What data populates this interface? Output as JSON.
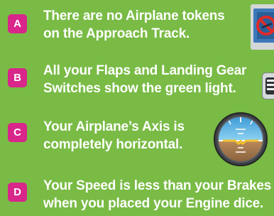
{
  "conditions": [
    {
      "letter": "A",
      "line1": "There are no Airplane tokens",
      "line2": "on the Approach Track."
    },
    {
      "letter": "B",
      "line1": "All your Flaps and Landing Gear",
      "line2": "Switches show the green light."
    },
    {
      "letter": "C",
      "line1": "Your Airplane’s Axis is",
      "line2": "completely horizontal."
    },
    {
      "letter": "D",
      "line1": "Your Speed is less than your Brakes",
      "line2": "when you placed your Engine dice."
    }
  ],
  "colors": {
    "background": "#79bb45",
    "badge": "#d8268a",
    "text": "#ffffff",
    "switch_light": "#6ccb3c",
    "no_symbol": "#e02a2a"
  },
  "icons": {
    "a": "no-airplane-token-icon",
    "b": "switch-icon",
    "c": "attitude-indicator-icon"
  }
}
